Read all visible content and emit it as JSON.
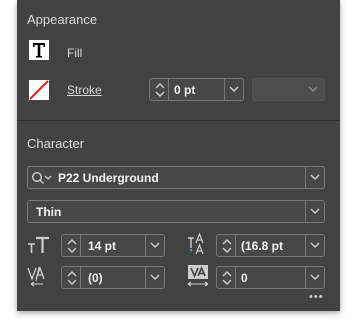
{
  "appearance": {
    "title": "Appearance",
    "fill_label": "Fill",
    "stroke_label": "Stroke",
    "stroke_weight": "0 pt"
  },
  "character": {
    "title": "Character",
    "font_family": "P22 Underground",
    "font_style": "Thin",
    "font_size": "14 pt",
    "leading": "(16.8 pt",
    "kerning": "(0)",
    "tracking": "0"
  },
  "more_label": "•••"
}
